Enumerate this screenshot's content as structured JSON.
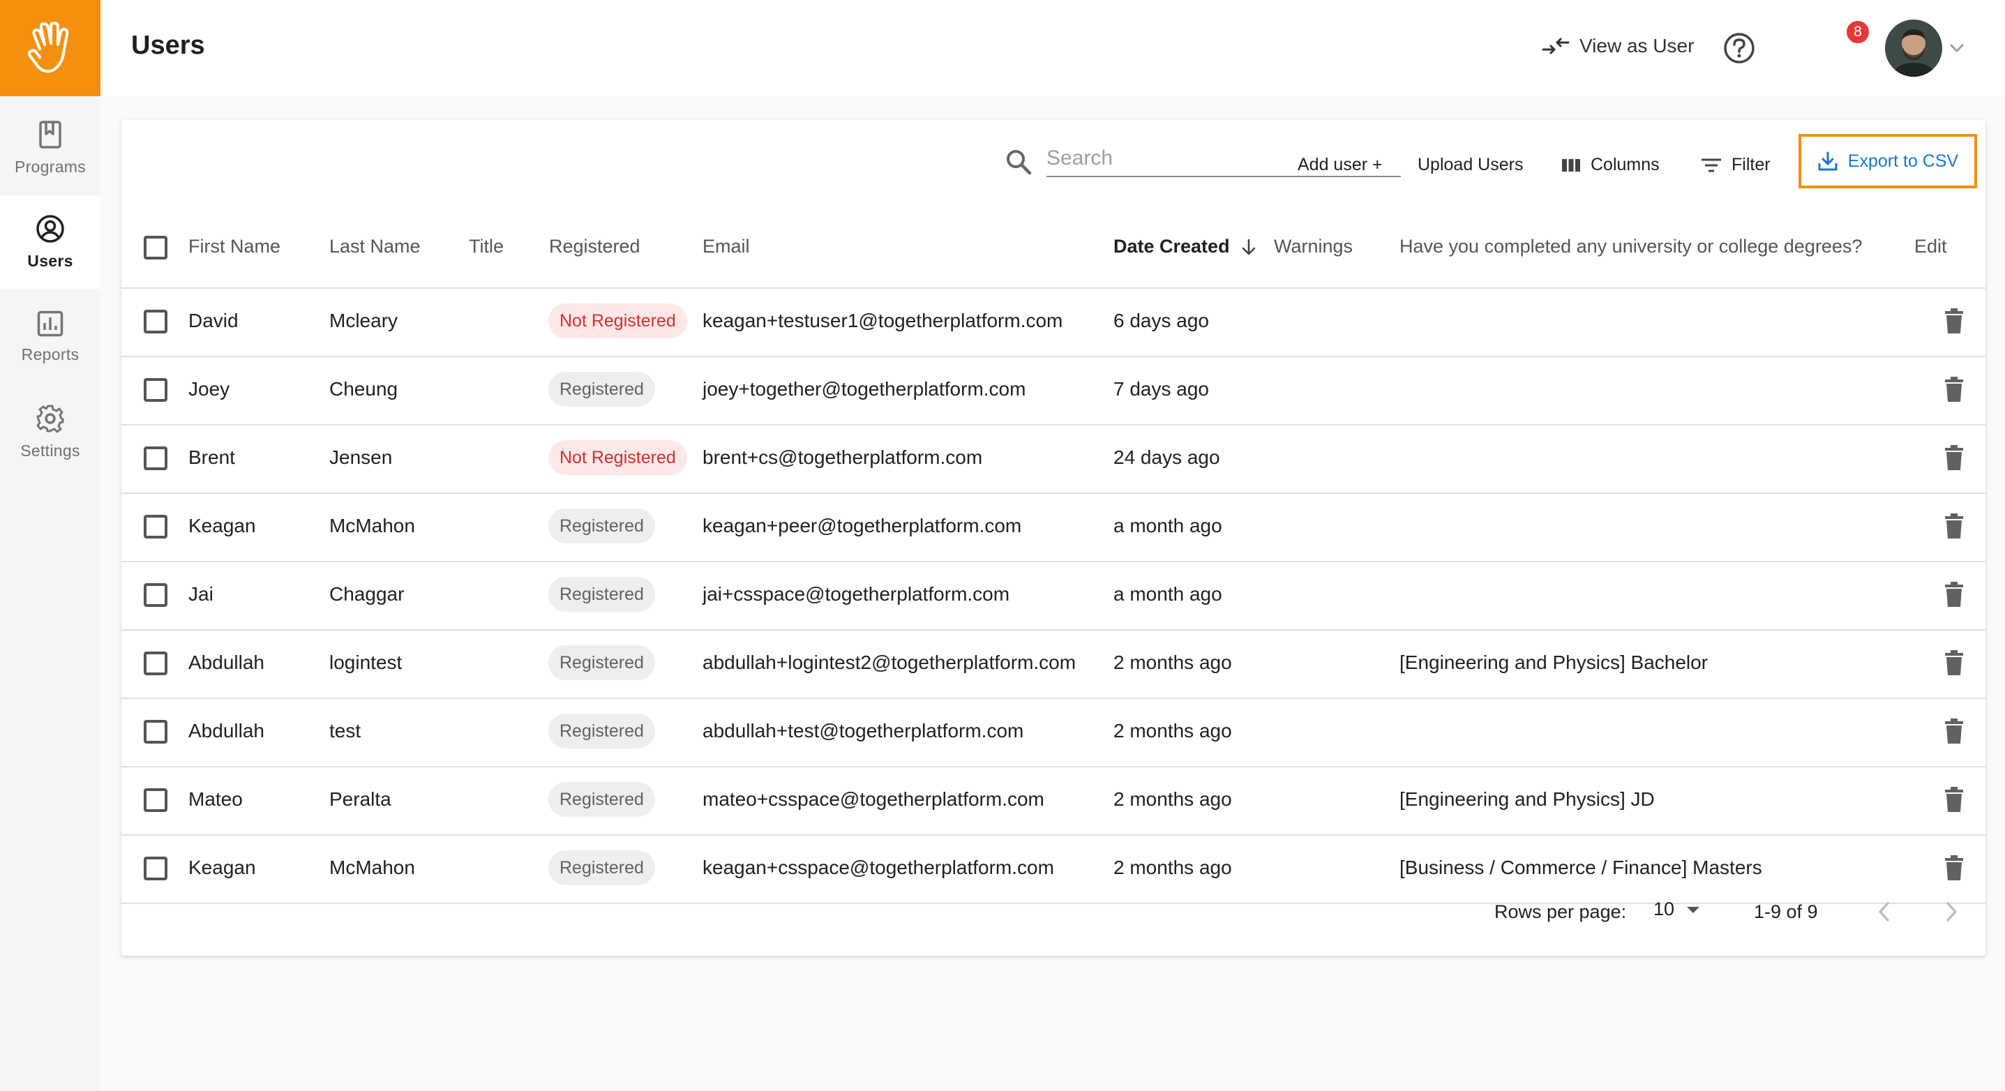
{
  "app": {
    "logo_icon": "waving-hand-icon",
    "accent_color": "#f5900f",
    "link_color": "#1976d2"
  },
  "sidebar": {
    "items": [
      {
        "label": "Programs",
        "icon": "book-icon",
        "active": false
      },
      {
        "label": "Users",
        "icon": "account-circle-icon",
        "active": true
      },
      {
        "label": "Reports",
        "icon": "bar-chart-icon",
        "active": false
      },
      {
        "label": "Settings",
        "icon": "gear-icon",
        "active": false
      }
    ]
  },
  "header": {
    "title": "Users",
    "view_as_user_label": "View as User",
    "help_badge_count": "8"
  },
  "toolbar": {
    "search_placeholder": "Search",
    "search_value": "",
    "add_user_label": "Add user +",
    "upload_users_label": "Upload Users",
    "columns_label": "Columns",
    "filter_label": "Filter",
    "export_label": "Export to CSV"
  },
  "table": {
    "columns": {
      "first_name": "First Name",
      "last_name": "Last Name",
      "title": "Title",
      "registered": "Registered",
      "email": "Email",
      "date_created": "Date Created",
      "warnings": "Warnings",
      "degrees": "Have you completed any university or college degrees?",
      "edit": "Edit"
    },
    "sort": {
      "column": "Date Created",
      "direction": "descending"
    },
    "rows": [
      {
        "first": "David",
        "last": "Mcleary",
        "title": "",
        "status": "Not Registered",
        "email": "keagan+testuser1@togetherplatform.com",
        "created": "6 days ago",
        "warnings": "",
        "degree": ""
      },
      {
        "first": "Joey",
        "last": "Cheung",
        "title": "",
        "status": "Registered",
        "email": "joey+together@togetherplatform.com",
        "created": "7 days ago",
        "warnings": "",
        "degree": ""
      },
      {
        "first": "Brent",
        "last": "Jensen",
        "title": "",
        "status": "Not Registered",
        "email": "brent+cs@togetherplatform.com",
        "created": "24 days ago",
        "warnings": "",
        "degree": ""
      },
      {
        "first": "Keagan",
        "last": "McMahon",
        "title": "",
        "status": "Registered",
        "email": "keagan+peer@togetherplatform.com",
        "created": "a month ago",
        "warnings": "",
        "degree": ""
      },
      {
        "first": "Jai",
        "last": "Chaggar",
        "title": "",
        "status": "Registered",
        "email": "jai+csspace@togetherplatform.com",
        "created": "a month ago",
        "warnings": "",
        "degree": ""
      },
      {
        "first": "Abdullah",
        "last": "logintest",
        "title": "",
        "status": "Registered",
        "email": "abdullah+logintest2@togetherplatform.com",
        "created": "2 months ago",
        "warnings": "",
        "degree": "[Engineering and Physics] Bachelor"
      },
      {
        "first": "Abdullah",
        "last": "test",
        "title": "",
        "status": "Registered",
        "email": "abdullah+test@togetherplatform.com",
        "created": "2 months ago",
        "warnings": "",
        "degree": ""
      },
      {
        "first": "Mateo",
        "last": "Peralta",
        "title": "",
        "status": "Registered",
        "email": "mateo+csspace@togetherplatform.com",
        "created": "2 months ago",
        "warnings": "",
        "degree": "[Engineering and Physics] JD"
      },
      {
        "first": "Keagan",
        "last": "McMahon",
        "title": "",
        "status": "Registered",
        "email": "keagan+csspace@togetherplatform.com",
        "created": "2 months ago",
        "warnings": "",
        "degree": "[Business / Commerce / Finance] Masters"
      }
    ]
  },
  "pagination": {
    "rows_per_page_label": "Rows per page:",
    "rows_per_page": "10",
    "range": "1-9 of 9"
  }
}
